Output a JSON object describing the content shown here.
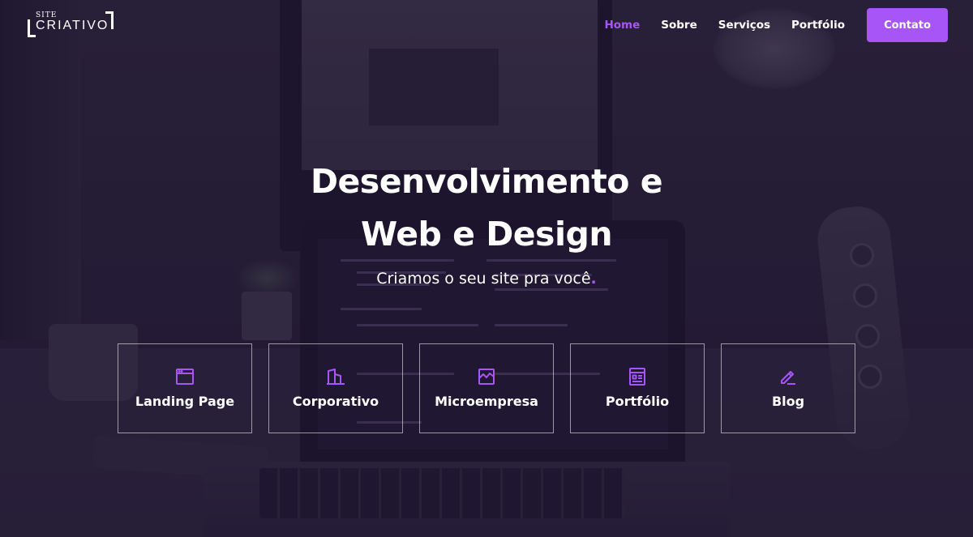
{
  "logo": {
    "small_text": "SITE",
    "main_text": "CRIATIVO"
  },
  "nav": {
    "items": [
      {
        "label": "Home",
        "active": true
      },
      {
        "label": "Sobre",
        "active": false
      },
      {
        "label": "Serviços",
        "active": false
      },
      {
        "label": "Portfólio",
        "active": false
      }
    ],
    "cta_label": "Contato"
  },
  "hero": {
    "title_line1": "Desenvolvimento e",
    "title_line2": "Web e Design",
    "subtitle": "Criamos o seu site pra você",
    "subtitle_dot": "."
  },
  "services": [
    {
      "label": "Landing Page",
      "icon": "browser-window-icon"
    },
    {
      "label": "Corporativo",
      "icon": "buildings-icon"
    },
    {
      "label": "Microempresa",
      "icon": "store-chart-icon"
    },
    {
      "label": "Portfólio",
      "icon": "article-layout-icon"
    },
    {
      "label": "Blog",
      "icon": "pencil-edit-icon"
    }
  ],
  "colors": {
    "accent": "#a855f7",
    "overlay": "#261840",
    "text": "#ffffff"
  }
}
